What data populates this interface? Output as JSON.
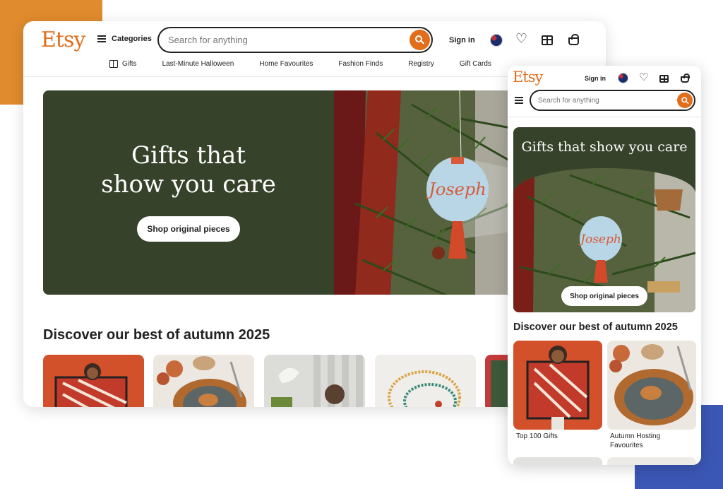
{
  "desktop": {
    "logo": "Etsy",
    "categories_label": "Categories",
    "search": {
      "placeholder": "Search for anything"
    },
    "signin_label": "Sign in",
    "nav": [
      "Gifts",
      "Last-Minute Halloween",
      "Home Favourites",
      "Fashion Finds",
      "Registry",
      "Gift Cards"
    ],
    "hero": {
      "title_line1": "Gifts that",
      "title_line2": "show you care",
      "button_label": "Shop original pieces",
      "ornament_text": "Joseph"
    },
    "section_title": "Discover our best of autumn 2025"
  },
  "mobile": {
    "logo": "Etsy",
    "signin_label": "Sign in",
    "search": {
      "placeholder": "Search for anything"
    },
    "hero": {
      "title": "Gifts that show you care",
      "button_label": "Shop original pieces",
      "ornament_text": "Joseph"
    },
    "section_title": "Discover our best of autumn 2025",
    "tiles": [
      {
        "caption": "Top 100 Gifts"
      },
      {
        "caption_line1": "Autumn Hosting",
        "caption_line2": "Favourites"
      }
    ]
  },
  "colors": {
    "brand_orange": "#e26d1b",
    "hero_green": "#37422a",
    "deco_orange": "#e08b2e",
    "deco_blue": "#3b57b5"
  },
  "icons": [
    "hamburger-icon",
    "search-icon",
    "flag-icon",
    "heart-icon",
    "gift-icon",
    "shopping-bag-icon"
  ]
}
